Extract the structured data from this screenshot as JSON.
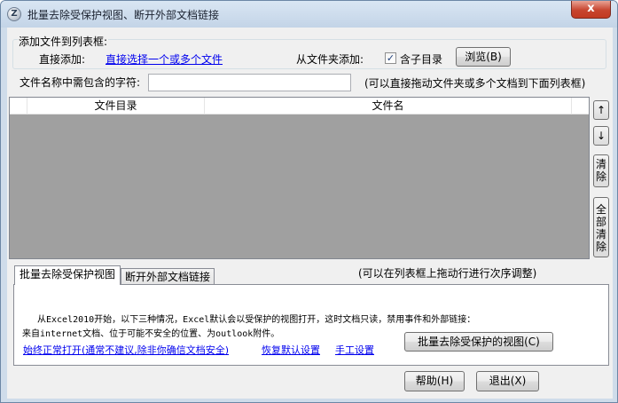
{
  "window": {
    "title": "批量去除受保护视图、断开外部文档链接",
    "icon_text": "Z",
    "close_glyph": "x"
  },
  "add_group": {
    "legend": "添加文件到列表框:",
    "direct_add_label": "直接添加:",
    "direct_add_link": "直接选择一个或多个文件",
    "folder_add_label": "从文件夹添加:",
    "subdir_checked": true,
    "subdir_label": "含子目录",
    "browse_button": "浏览(B)"
  },
  "filter": {
    "label": "文件名称中需包含的字符:",
    "value": "",
    "hint": "(可以直接拖动文件夹或多个文档到下面列表框)"
  },
  "list": {
    "columns": [
      "文件目录",
      "文件名"
    ]
  },
  "side_buttons": {
    "up": "↑",
    "down": "↓",
    "clear": "清除",
    "clear_all": "全部清除"
  },
  "tabs": [
    {
      "label": "批量去除受保护视图",
      "active": true
    },
    {
      "label": "断开外部文档链接",
      "active": false
    }
  ],
  "reorder_hint": "(可以在列表框上拖动行进行次序调整)",
  "panel": {
    "desc_line1": "从Excel2010开始，以下三种情况，Excel默认会以受保护的视图打开，这时文档只读，禁用事件和外部链接：",
    "desc_line2": "来自internet文档、位于可能不安全的位置、为outlook附件。",
    "link_always_open": "始终正常打开(通常不建议,除非你确信文档安全)",
    "link_restore_default": "恢复默认设置",
    "link_manual": "手工设置",
    "run_button": "批量去除受保护的视图(C)"
  },
  "footer": {
    "help_button": "帮助(H)",
    "exit_button": "退出(X)"
  }
}
